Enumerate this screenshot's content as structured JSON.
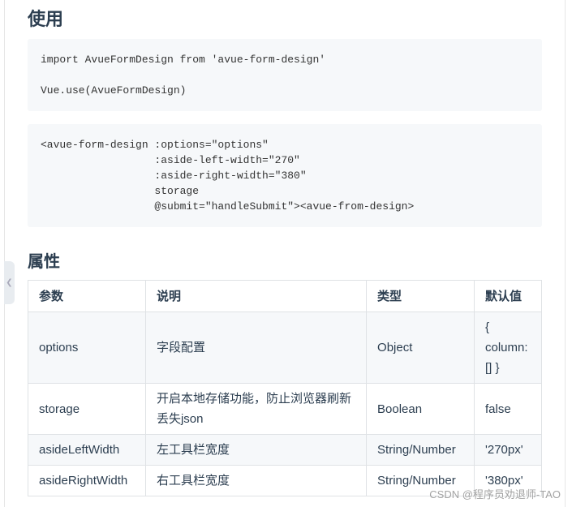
{
  "sections": {
    "usage_title": "使用",
    "props_title": "属性"
  },
  "code": {
    "block1": "import AvueFormDesign from 'avue-form-design'\n\nVue.use(AvueFormDesign)",
    "block2": "<avue-form-design :options=\"options\"\n                  :aside-left-width=\"270\"\n                  :aside-right-width=\"380\"\n                  storage\n                  @submit=\"handleSubmit\"><avue-from-design>"
  },
  "table": {
    "headers": [
      "参数",
      "说明",
      "类型",
      "默认值"
    ],
    "rows": [
      [
        "options",
        "字段配置",
        "Object",
        "{ column: [] }"
      ],
      [
        "storage",
        "开启本地存储功能，防止浏览器刷新丢失json",
        "Boolean",
        "false"
      ],
      [
        "asideLeftWidth",
        "左工具栏宽度",
        "String/Number",
        "'270px'"
      ],
      [
        "asideRightWidth",
        "右工具栏宽度",
        "String/Number",
        "'380px'"
      ]
    ]
  },
  "watermark": "CSDN @程序员劝退师-TAO",
  "sidebar_toggle_icon": "chevron-left-icon"
}
